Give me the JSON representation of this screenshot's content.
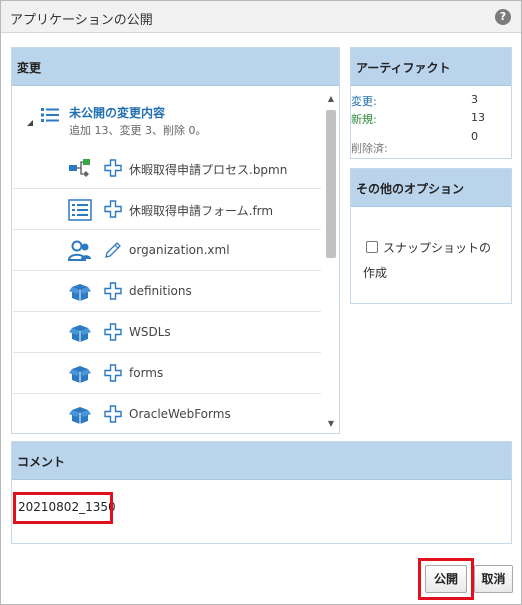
{
  "dialog": {
    "title": "アプリケーションの公開",
    "help_icon": "question-circle-icon"
  },
  "changes": {
    "header": "変更",
    "root": {
      "title": "未公開の変更内容",
      "summary": "追加 13、変更 3、削除 0。"
    },
    "items": [
      {
        "label": "休暇取得申請プロセス.bpmn",
        "icon": "process-icon",
        "action": "added-plus-icon"
      },
      {
        "label": "休暇取得申請フォーム.frm",
        "icon": "form-icon",
        "action": "added-plus-icon"
      },
      {
        "label": "organization.xml",
        "icon": "organization-icon",
        "action": "modified-pencil-icon"
      },
      {
        "label": "definitions",
        "icon": "package-icon",
        "action": "added-plus-icon"
      },
      {
        "label": "WSDLs",
        "icon": "package-icon",
        "action": "added-plus-icon"
      },
      {
        "label": "forms",
        "icon": "package-icon",
        "action": "added-plus-icon"
      },
      {
        "label": "OracleWebForms",
        "icon": "package-icon",
        "action": "added-plus-icon"
      }
    ]
  },
  "artifacts": {
    "header": "アーティファクト",
    "changed_label": "変更:",
    "changed_value": "3",
    "new_label": "新規:",
    "new_value": "13",
    "deleted_label": "削除済:",
    "deleted_value": "0"
  },
  "options": {
    "header": "その他のオプション",
    "snapshot_label_line1": "スナップショットの",
    "snapshot_label_line2": "作成",
    "snapshot_checked": false
  },
  "comment": {
    "header": "コメント",
    "value": "20210802_1350"
  },
  "buttons": {
    "publish": "公開",
    "cancel": "取消"
  },
  "colors": {
    "panel_header": "#bad4ec",
    "link_blue": "#1f6fb2",
    "highlight_red": "#e0101c"
  }
}
